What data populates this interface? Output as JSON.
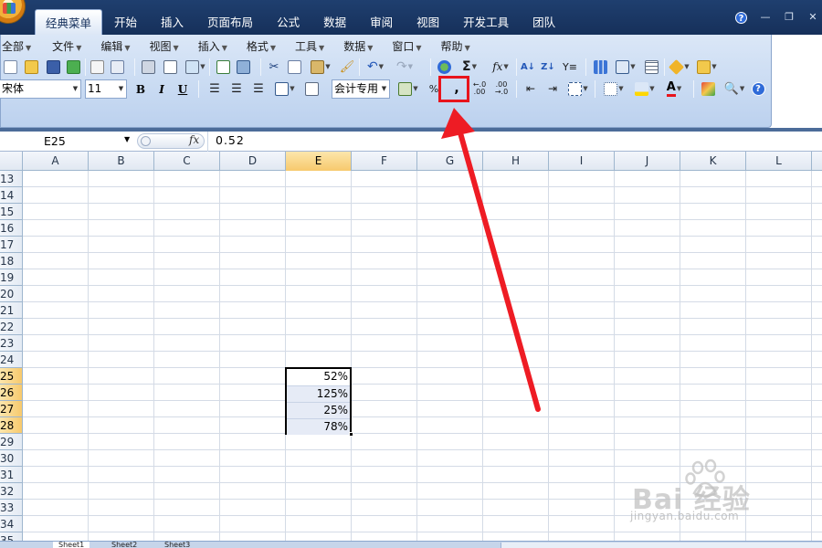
{
  "ribbon_tabs": [
    "经典菜单",
    "开始",
    "插入",
    "页面布局",
    "公式",
    "数据",
    "审阅",
    "视图",
    "开发工具",
    "团队"
  ],
  "active_tab_index": 0,
  "menu_bar": [
    "全部",
    "文件",
    "编辑",
    "视图",
    "插入",
    "格式",
    "工具",
    "数据",
    "窗口",
    "帮助"
  ],
  "toolbar": {
    "font_name": "宋体",
    "font_size": "11",
    "bold_label": "B",
    "italic_label": "I",
    "underline_label": "U",
    "number_format": "会计专用",
    "percent_label": "%",
    "comma_label": ",",
    "increase_decimal_label": "+.0 .00",
    "decrease_decimal_label": ".00 →.0",
    "highlighted_button": "comma-style-button"
  },
  "formula_bar": {
    "name_box": "E25",
    "fx_label": "fx",
    "content": "0.52"
  },
  "columns": [
    "A",
    "B",
    "C",
    "D",
    "E",
    "F",
    "G",
    "H",
    "I",
    "J",
    "K",
    "L"
  ],
  "selected_column": "E",
  "rows": [
    "13",
    "14",
    "15",
    "16",
    "17",
    "18",
    "19",
    "20",
    "21",
    "22",
    "23",
    "24",
    "25",
    "26",
    "27",
    "28",
    "29",
    "30",
    "31",
    "32",
    "33",
    "34",
    "35"
  ],
  "selected_rows": [
    "25",
    "26",
    "27",
    "28"
  ],
  "cells": [
    {
      "ref": "E25",
      "value": "52%"
    },
    {
      "ref": "E26",
      "value": "125%"
    },
    {
      "ref": "E27",
      "value": "25%"
    },
    {
      "ref": "E28",
      "value": "78%"
    }
  ],
  "sheet_tabs": [
    "Sheet1",
    "Sheet2",
    "Sheet3"
  ],
  "colors": {
    "annotation_red": "#e8141c",
    "ribbon_blue": "#c8daf2",
    "selection_header": "#f7c96c"
  },
  "watermark": {
    "brand": "Bai 经验",
    "url": "jingyan.baidu.com"
  }
}
